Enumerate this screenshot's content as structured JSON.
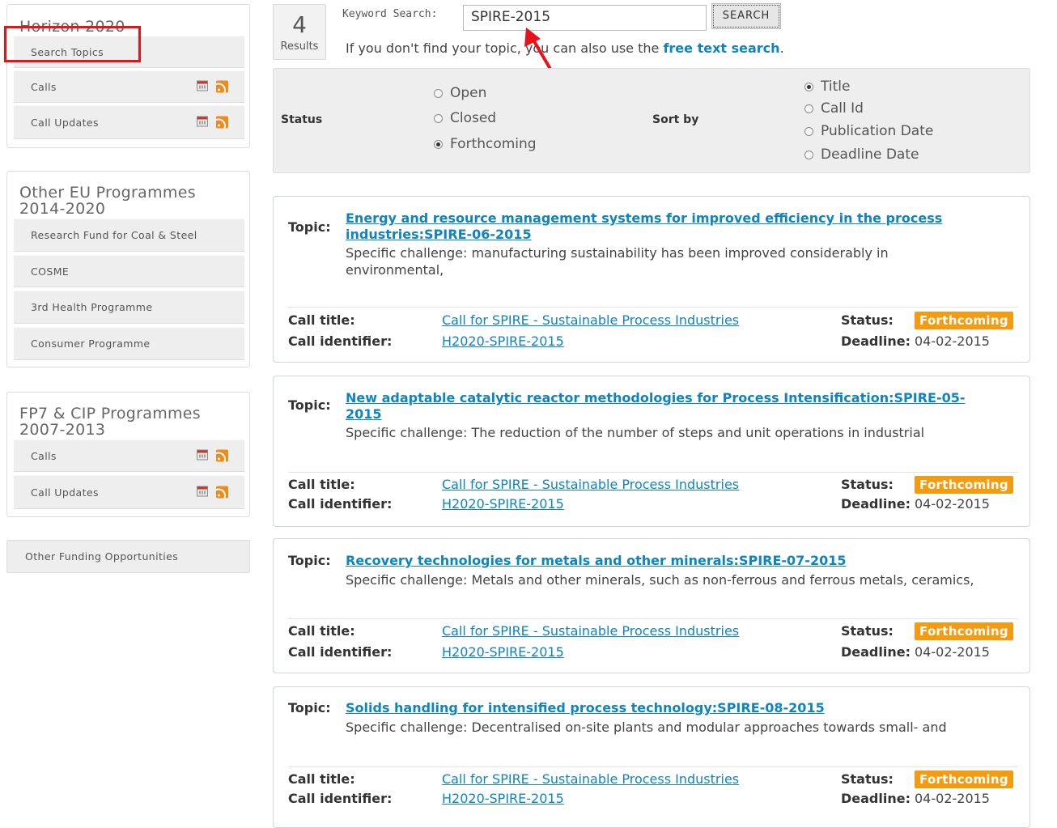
{
  "sidebar": {
    "horizon": {
      "title": "Horizon 2020",
      "items": [
        {
          "label": "Search Topics"
        },
        {
          "label": "Calls"
        },
        {
          "label": "Call Updates"
        }
      ]
    },
    "other_eu": {
      "title_line1": "Other EU Programmes",
      "title_line2": "2014-2020",
      "items": [
        {
          "label": "Research Fund for Coal & Steel"
        },
        {
          "label": "COSME"
        },
        {
          "label": "3rd Health Programme"
        },
        {
          "label": "Consumer Programme"
        }
      ]
    },
    "fp7": {
      "title_line1": "FP7 & CIP Programmes",
      "title_line2": "2007-2013",
      "items": [
        {
          "label": "Calls"
        },
        {
          "label": "Call Updates"
        }
      ]
    },
    "other_funding": "Other Funding Opportunities"
  },
  "results": {
    "count": "4",
    "label": "Results"
  },
  "search": {
    "label": "Keyword Search:",
    "value": "SPIRE-2015",
    "button": "SEARCH",
    "hint_prefix": "If you don't find your topic, you can also use the ",
    "hint_link": "free text search",
    "hint_suffix": "."
  },
  "filters": {
    "status_label": "Status",
    "status_options": [
      "Open",
      "Closed",
      "Forthcoming"
    ],
    "status_selected": "Forthcoming",
    "sort_label": "Sort by",
    "sort_options": [
      "Title",
      "Call Id",
      "Publication Date",
      "Deadline Date"
    ],
    "sort_selected": "Title"
  },
  "labels": {
    "topic": "Topic:",
    "call_title": "Call title:",
    "call_identifier": "Call identifier:",
    "status": "Status:",
    "deadline": "Deadline:"
  },
  "topics": [
    {
      "title": "Energy and resource management systems for improved efficiency in the process industries:SPIRE-06-2015",
      "challenge": "Specific challenge: manufacturing sustainability has been improved considerably in environmental,",
      "call_title": "Call for SPIRE - Sustainable Process Industries",
      "call_identifier": "H2020-SPIRE-2015",
      "status": "Forthcoming",
      "deadline": "04-02-2015"
    },
    {
      "title": "New adaptable catalytic reactor methodologies for Process Intensification:SPIRE-05-2015",
      "challenge": "Specific challenge: The reduction of the number of steps and unit operations in industrial",
      "call_title": "Call for SPIRE - Sustainable Process Industries",
      "call_identifier": "H2020-SPIRE-2015",
      "status": "Forthcoming",
      "deadline": "04-02-2015"
    },
    {
      "title": "Recovery technologies for metals and other minerals:SPIRE-07-2015",
      "challenge": "Specific challenge: Metals and other minerals, such as non-ferrous and ferrous metals, ceramics,",
      "call_title": "Call for SPIRE - Sustainable Process Industries",
      "call_identifier": "H2020-SPIRE-2015",
      "status": "Forthcoming",
      "deadline": "04-02-2015"
    },
    {
      "title": "Solids handling for intensified process technology:SPIRE-08-2015",
      "challenge": "Specific challenge: Decentralised on-site plants and modular approaches towards small- and",
      "call_title": "Call for SPIRE - Sustainable Process Industries",
      "call_identifier": "H2020-SPIRE-2015",
      "status": "Forthcoming",
      "deadline": "04-02-2015"
    }
  ],
  "colors": {
    "link": "#0e84c0",
    "badge": "#f39c12",
    "annotation": "#e8121b"
  }
}
